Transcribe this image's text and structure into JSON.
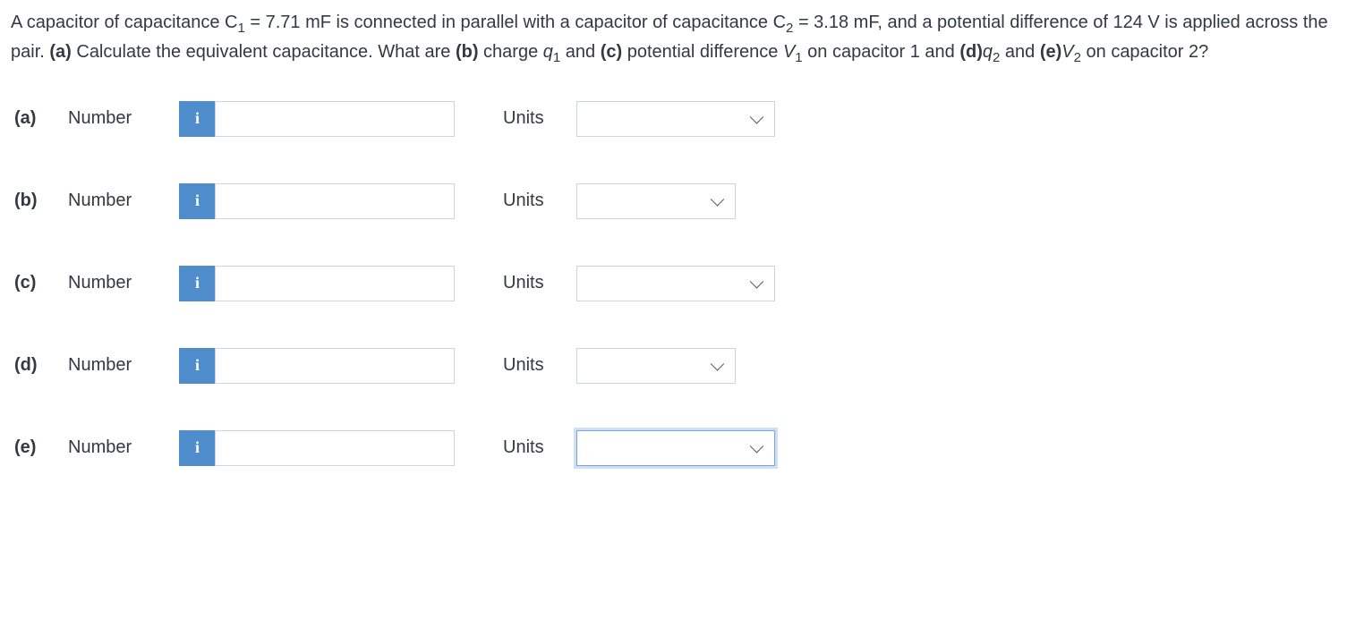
{
  "question": {
    "full_text": "A capacitor of capacitance C₁ = 7.71 mF is connected in parallel with a capacitor of capacitance C₂ = 3.18 mF, and a potential difference of 124 V is applied across the pair. (a) Calculate the equivalent capacitance. What are (b) charge q₁ and (c) potential difference V₁ on capacitor 1 and (d)q₂ and (e)V₂ on capacitor 2?"
  },
  "labels": {
    "number": "Number",
    "units": "Units",
    "info": "i"
  },
  "rows": [
    {
      "part": "(a)",
      "select_width": "wide",
      "select_focused": false
    },
    {
      "part": "(b)",
      "select_width": "narrow",
      "select_focused": false
    },
    {
      "part": "(c)",
      "select_width": "wide",
      "select_focused": false
    },
    {
      "part": "(d)",
      "select_width": "narrow",
      "select_focused": false
    },
    {
      "part": "(e)",
      "select_width": "wide",
      "select_focused": true
    }
  ]
}
